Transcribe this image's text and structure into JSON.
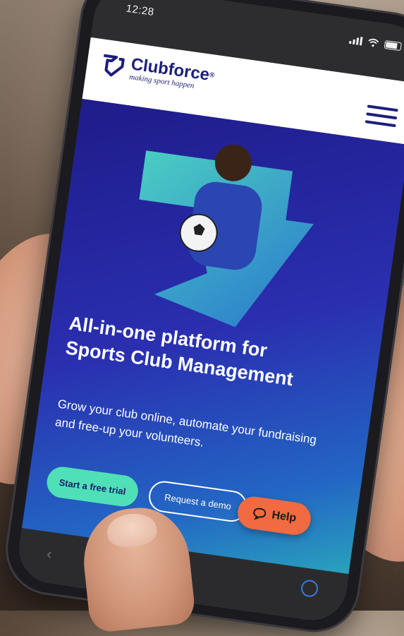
{
  "status": {
    "time": "12:28"
  },
  "brand": {
    "name": "Clubforce",
    "registered": "®",
    "tagline": "making sport happen",
    "color": "#1d1f7a"
  },
  "hero": {
    "title_line1": "All-in-one platform for",
    "title_line2": "Sports Club Management",
    "subtitle": "Grow your club online, automate your fundraising and free-up your volunteers.",
    "cta_primary": "Start a free trial",
    "cta_secondary": "Request a demo"
  },
  "help": {
    "label": "Help",
    "color": "#f16a41"
  },
  "colors": {
    "primary": "#1f1c8a",
    "accent": "#4fe0b8"
  },
  "icons": [
    "signal-icon",
    "wifi-icon",
    "battery-icon",
    "menu-icon",
    "chat-icon",
    "back-icon",
    "forward-icon",
    "share-icon",
    "compass-icon"
  ]
}
